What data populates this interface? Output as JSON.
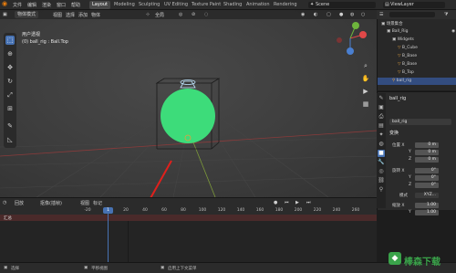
{
  "menubar": {
    "items": [
      "文件",
      "编辑",
      "渲染",
      "窗口",
      "帮助"
    ],
    "workspaces": [
      "Layout",
      "Modeling",
      "Sculpting",
      "UV Editing",
      "Texture Paint",
      "Shading",
      "Animation",
      "Rendering"
    ],
    "active_workspace": "Layout",
    "scene": "Scene",
    "view_layer": "ViewLayer"
  },
  "viewport": {
    "mode": "物体模式",
    "menus": [
      "视图",
      "选择",
      "添加",
      "物体"
    ],
    "transform_orientation": "全局",
    "overlay_line1": "用户透视",
    "overlay_line2": "(0) ball_rig : Ball.Top",
    "object_color": "#3ddc7a"
  },
  "toolbar": {
    "tools": [
      "select-icon",
      "cursor-icon",
      "move-icon",
      "rotate-icon",
      "scale-icon",
      "transform-icon",
      "annotate-icon",
      "measure-icon"
    ]
  },
  "outliner": {
    "search_placeholder": "",
    "rows": [
      {
        "label": "场景集合",
        "indent": 0
      },
      {
        "label": "Ball_Rig",
        "indent": 1
      },
      {
        "label": "Widgets",
        "indent": 2
      },
      {
        "label": "B_Cube",
        "indent": 3
      },
      {
        "label": "B_Base",
        "indent": 3
      },
      {
        "label": "B_Base",
        "indent": 3
      },
      {
        "label": "B_Top",
        "indent": 3
      },
      {
        "label": "ball_rig",
        "indent": 2,
        "selected": true
      }
    ]
  },
  "properties": {
    "object_name": "ball_rig",
    "sub_name": "ball_rig",
    "transform_header": "变换",
    "location_label": "位置 X",
    "location": [
      "0 m",
      "0 m",
      "0 m"
    ],
    "rotation_label": "旋转 X",
    "rotation": [
      "0°",
      "0°",
      "0°"
    ],
    "mode_label": "模式",
    "mode_value": "XYZ...",
    "scale_label": "缩放 X",
    "scale": [
      "1.00",
      "1.00",
      "1.00"
    ],
    "axis_y": "Y",
    "axis_z": "Z"
  },
  "timeline": {
    "menus": [
      "回放",
      "抠像(插帧)",
      "视图",
      "标记"
    ],
    "ticks": [
      "-20",
      "0",
      "20",
      "40",
      "60",
      "80",
      "100",
      "120",
      "140",
      "160",
      "180",
      "200",
      "220",
      "240",
      "260"
    ],
    "current_frame": "1",
    "track_label": "汇总"
  },
  "status": {
    "items": [
      "选择",
      "平移视图",
      "启用上下文菜单"
    ]
  },
  "watermark": "棒森下载"
}
